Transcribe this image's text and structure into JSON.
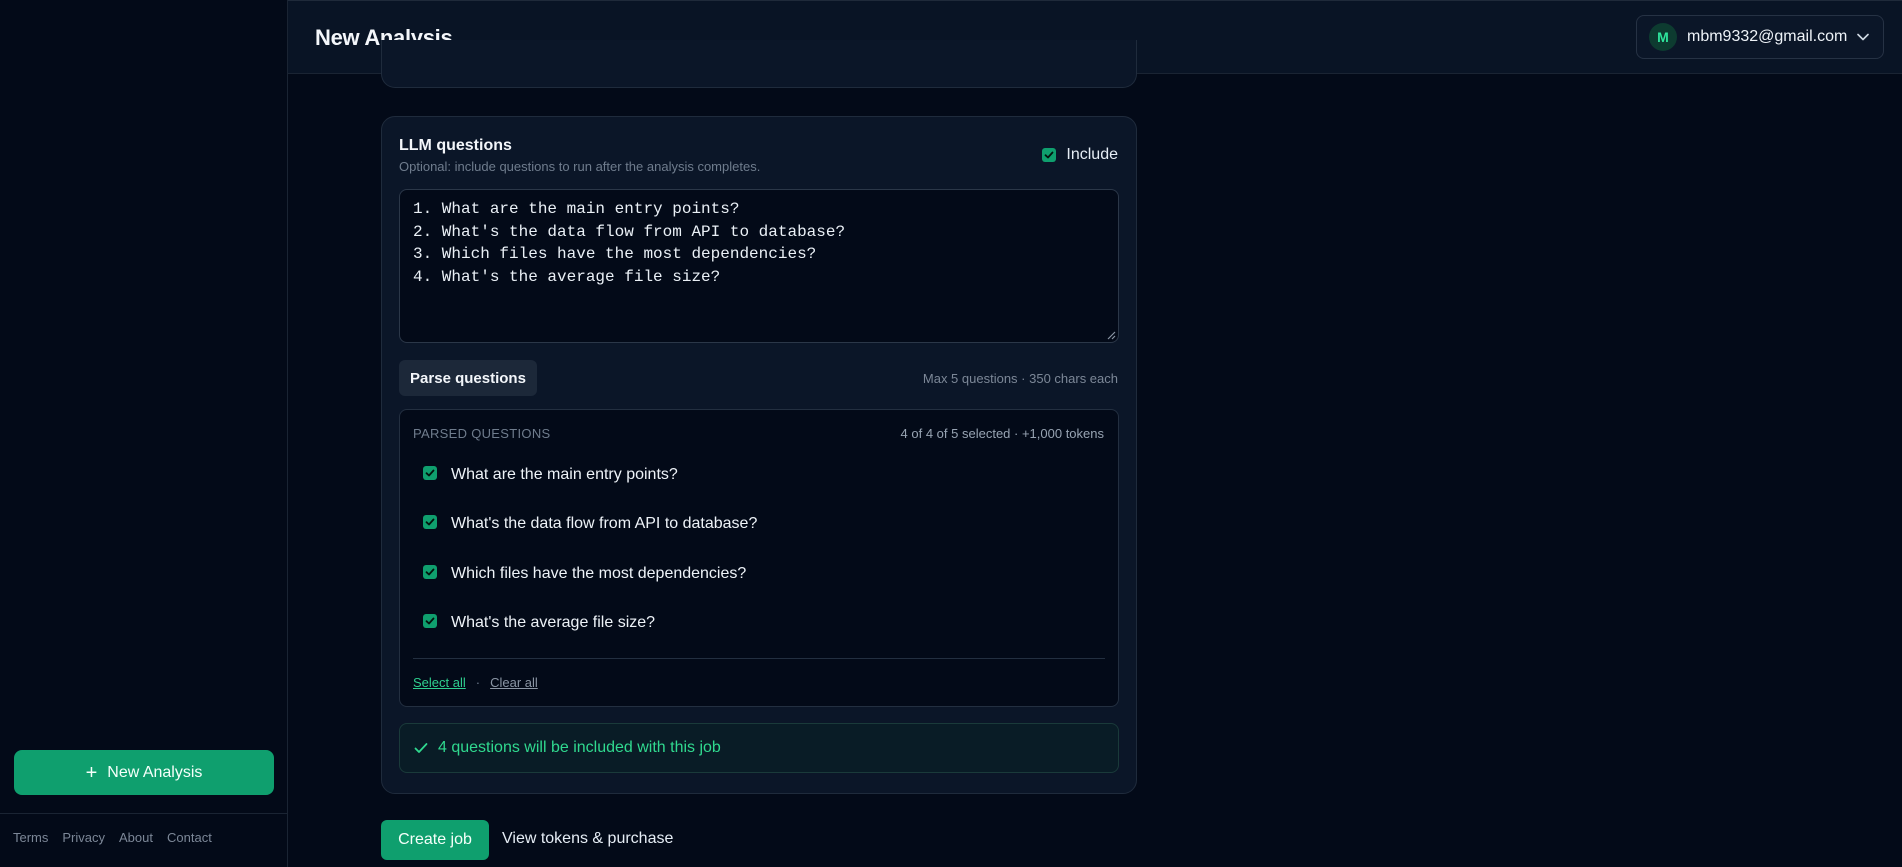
{
  "header": {
    "title": "New Analysis",
    "user_initial": "M",
    "user_email": "mbm9332@gmail.com"
  },
  "sidebar": {
    "new_analysis_label": "New Analysis",
    "footer_links": [
      "Terms",
      "Privacy",
      "About",
      "Contact"
    ]
  },
  "llm_card": {
    "title": "LLM questions",
    "subtitle": "Optional: include questions to run after the analysis completes.",
    "include_label": "Include",
    "include_checked": true,
    "textarea_lines": [
      "1. What are the main entry points?",
      "2. What's the data flow from API to database?",
      "3. Which files have the most dependencies?",
      "4. What's the average file size?"
    ],
    "parse_button": "Parse questions",
    "limits_text": "Max 5 questions · 350 chars each",
    "parsed": {
      "heading": "PARSED QUESTIONS",
      "count_text": "4 of 4 of 5 selected · +1,000 tokens",
      "questions": [
        {
          "text": "What are the main entry points?",
          "checked": true
        },
        {
          "text": "What's the data flow from API to database?",
          "checked": true
        },
        {
          "text": "Which files have the most dependencies?",
          "checked": true
        },
        {
          "text": "What's the average file size?",
          "checked": true
        }
      ],
      "select_all": "Select all",
      "separator": "·",
      "clear_all": "Clear all"
    },
    "banner_text": "4 questions will be included with this job"
  },
  "actions": {
    "create_job": "Create job",
    "view_tokens": "View tokens & purchase"
  },
  "colors": {
    "accent": "#0f9f6e",
    "accent_text": "#30d98f",
    "background": "#030a18",
    "card": "#0b1628"
  }
}
